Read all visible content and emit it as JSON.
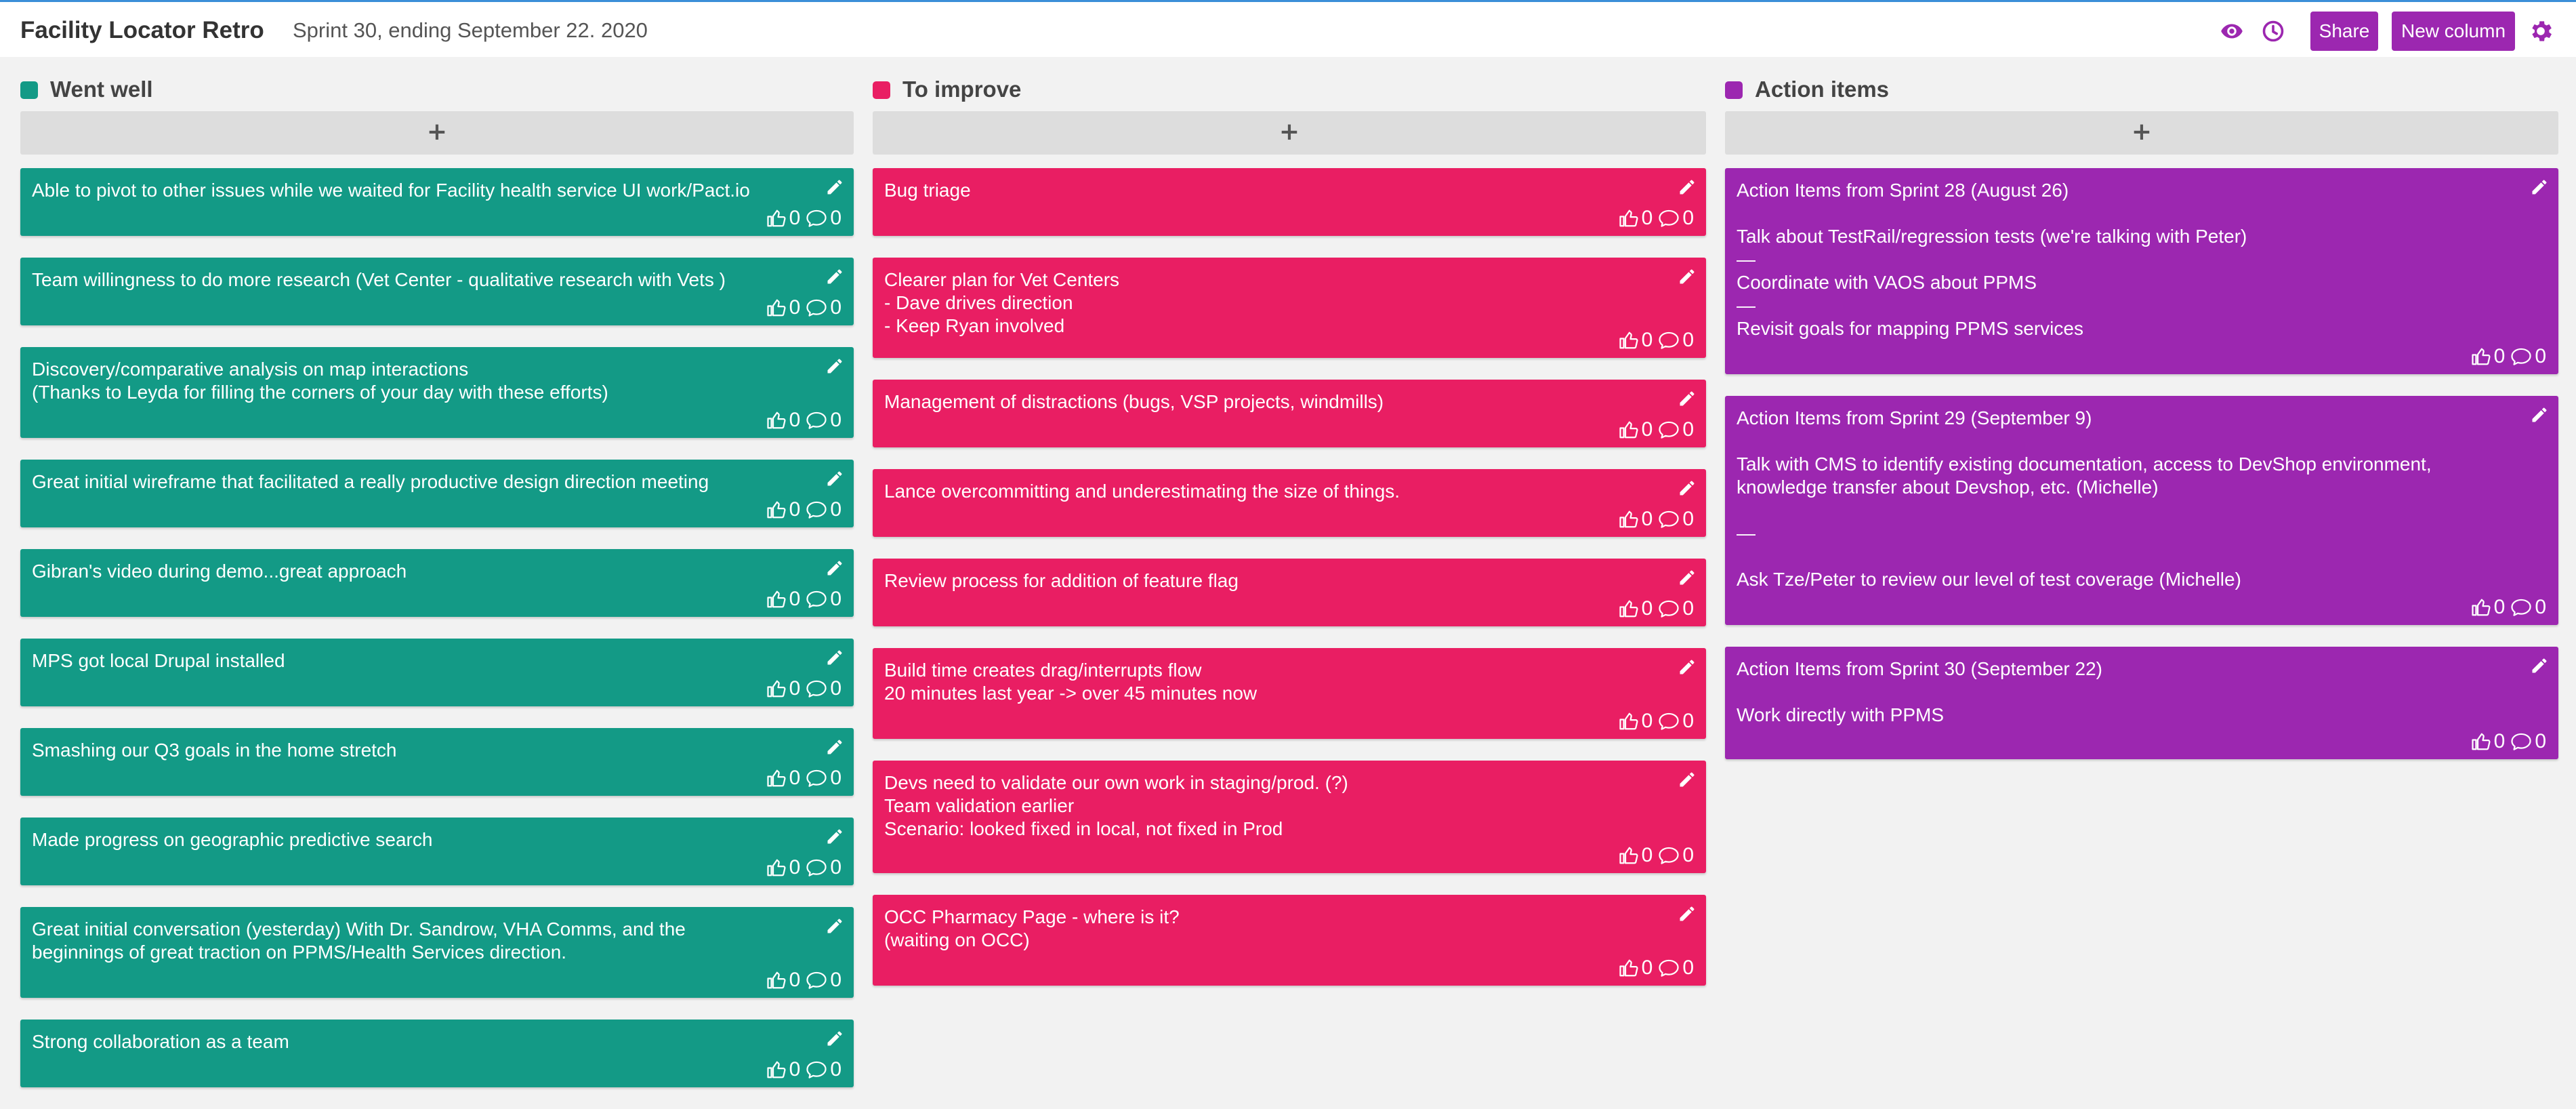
{
  "header": {
    "title": "Facility Locator Retro",
    "subtitle": "Sprint 30, ending September 22. 2020",
    "share_label": "Share",
    "new_column_label": "New column",
    "icons": [
      "eye-icon",
      "clock-icon",
      "gear-icon"
    ],
    "accent_color": "#9c27b0"
  },
  "columns": [
    {
      "title": "Went well",
      "color": "#139a86",
      "add_label": "+",
      "cards": [
        {
          "text": "Able to pivot to other issues while we waited for Facility health service UI work/Pact.io",
          "likes": "0",
          "comments": "0"
        },
        {
          "text": "Team willingness to do more research (Vet Center - qualitative research with Vets )",
          "likes": "0",
          "comments": "0"
        },
        {
          "text": "Discovery/comparative analysis on map interactions\n(Thanks to Leyda for filling the corners of your day with these efforts)",
          "likes": "0",
          "comments": "0"
        },
        {
          "text": "Great initial wireframe that facilitated a really productive design direction meeting",
          "likes": "0",
          "comments": "0"
        },
        {
          "text": "Gibran's video during demo...great approach",
          "likes": "0",
          "comments": "0"
        },
        {
          "text": "MPS got local Drupal installed",
          "likes": "0",
          "comments": "0"
        },
        {
          "text": "Smashing our Q3 goals in the home stretch",
          "likes": "0",
          "comments": "0"
        },
        {
          "text": "Made progress on geographic predictive search",
          "likes": "0",
          "comments": "0"
        },
        {
          "text": "Great initial conversation (yesterday) With Dr. Sandrow, VHA Comms, and the beginnings of great traction on PPMS/Health Services direction.",
          "likes": "0",
          "comments": "0"
        },
        {
          "text": "Strong collaboration as a team",
          "likes": "0",
          "comments": "0"
        }
      ]
    },
    {
      "title": "To improve",
      "color": "#e91e63",
      "add_label": "+",
      "cards": [
        {
          "text": "Bug triage",
          "likes": "0",
          "comments": "0"
        },
        {
          "text": "Clearer plan for Vet Centers\n- Dave drives direction\n- Keep Ryan involved",
          "likes": "0",
          "comments": "0"
        },
        {
          "text": "Management of distractions (bugs, VSP projects, windmills)",
          "likes": "0",
          "comments": "0"
        },
        {
          "text": "Lance overcommitting and underestimating the size of things.",
          "likes": "0",
          "comments": "0"
        },
        {
          "text": "Review process for addition of feature flag",
          "likes": "0",
          "comments": "0"
        },
        {
          "text": "Build time creates drag/interrupts flow\n20 minutes last year -> over 45 minutes now",
          "likes": "0",
          "comments": "0"
        },
        {
          "text": "Devs need to validate our own work in staging/prod. (?)\nTeam validation earlier\nScenario: looked fixed in local, not fixed in Prod",
          "likes": "0",
          "comments": "0"
        },
        {
          "text": "OCC Pharmacy Page - where is it?\n(waiting on OCC)",
          "likes": "0",
          "comments": "0"
        }
      ]
    },
    {
      "title": "Action items",
      "color": "#9c27b0",
      "add_label": "+",
      "cards": [
        {
          "text": "Action Items from Sprint 28 (August 26)\n\nTalk about TestRail/regression tests (we're talking with Peter)\n—\nCoordinate with VAOS about PPMS\n—\nRevisit goals for mapping PPMS services",
          "likes": "0",
          "comments": "0"
        },
        {
          "text": "Action Items from Sprint 29 (September 9)\n\nTalk with CMS to identify existing documentation, access to DevShop environment, knowledge transfer about Devshop, etc. (Michelle)\n\n—\n\nAsk Tze/Peter to review our level of test coverage (Michelle)",
          "likes": "0",
          "comments": "0"
        },
        {
          "text": "Action Items from Sprint 30 (September 22)\n\nWork directly with PPMS",
          "likes": "0",
          "comments": "0"
        }
      ]
    }
  ]
}
